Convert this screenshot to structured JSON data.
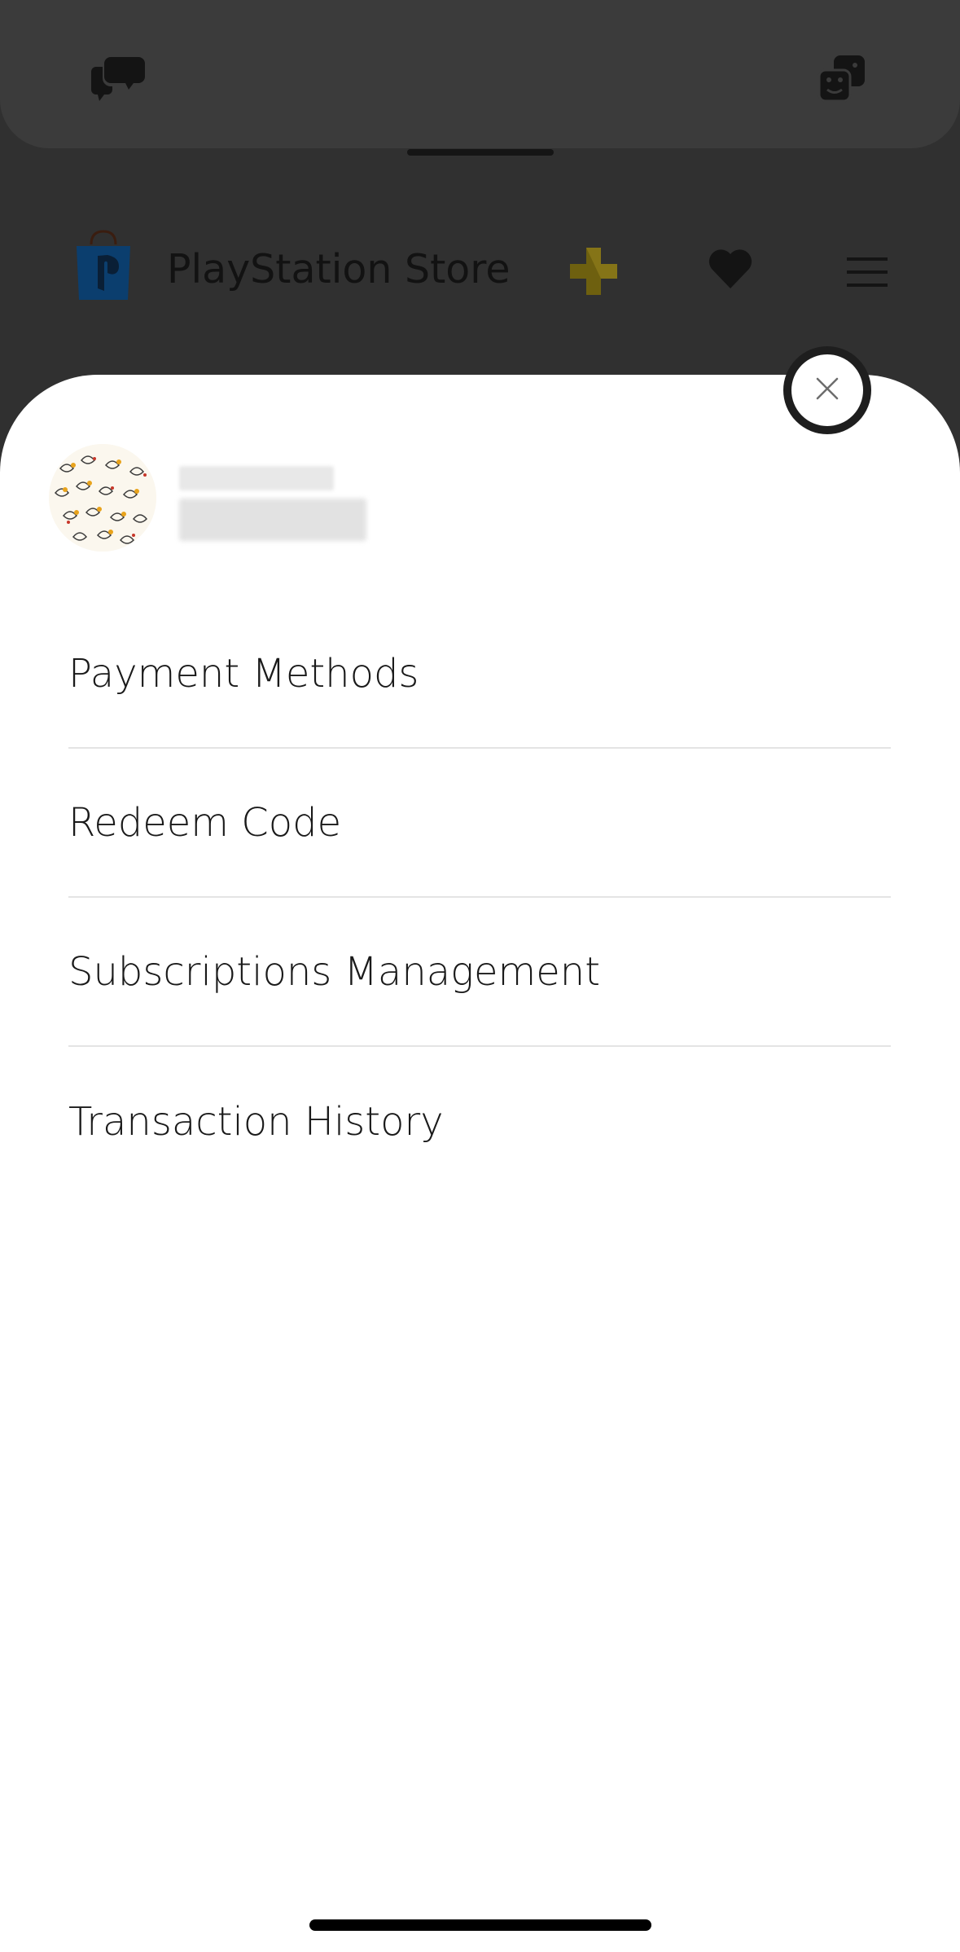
{
  "background_app": {
    "store_title": "PlayStation Store",
    "icons": [
      "chat-icon",
      "game-icon",
      "playstation-store-icon",
      "ps-plus-icon",
      "wishlist-heart-icon",
      "hamburger-menu-icon"
    ]
  },
  "account_sheet": {
    "close_icon": "close-icon",
    "menu_items": [
      {
        "label": "Payment Methods"
      },
      {
        "label": "Redeem Code"
      },
      {
        "label": "Subscriptions Management"
      },
      {
        "label": "Transaction History"
      }
    ]
  },
  "colors": {
    "overlay": "#303030",
    "sheet": "#ffffff",
    "divider": "#e4e4e4",
    "ps_blue": "#0b5ea6",
    "ps_plus_gold": "#8a7a15"
  }
}
